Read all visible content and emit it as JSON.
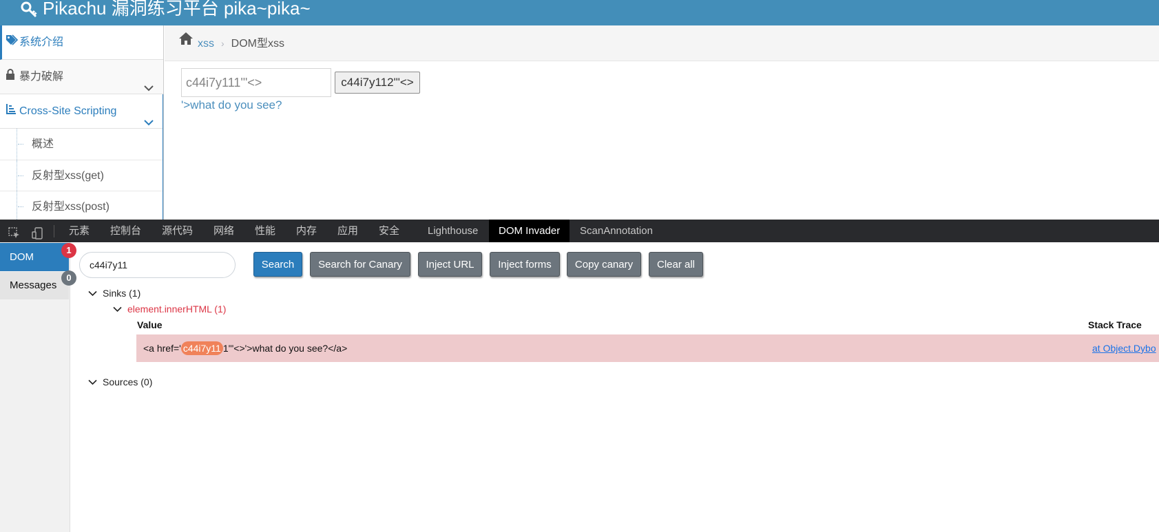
{
  "header": {
    "title": "Pikachu 漏洞练习平台 pika~pika~"
  },
  "sidebar": {
    "items": [
      {
        "label": "系统介绍",
        "icon": "tag-icon"
      },
      {
        "label": "暴力破解",
        "icon": "lock-icon"
      },
      {
        "label": "Cross-Site Scripting",
        "icon": "list-icon"
      }
    ],
    "subitems": [
      {
        "label": "概述"
      },
      {
        "label": "反射型xss(get)"
      },
      {
        "label": "反射型xss(post)"
      }
    ]
  },
  "breadcrumb": {
    "link": "xss",
    "current": "DOM型xss"
  },
  "xss_form": {
    "input_value": "c44i7y111'\"<>",
    "button_label": "c44i7y112'\"<>",
    "result_link": "'>what do you see?"
  },
  "devtools": {
    "tabs": [
      "元素",
      "控制台",
      "源代码",
      "网络",
      "性能",
      "内存",
      "应用",
      "安全",
      "Lighthouse",
      "DOM Invader",
      "ScanAnnotation"
    ],
    "active_tab": "DOM Invader"
  },
  "invader": {
    "left_tabs": {
      "dom": "DOM",
      "messages": "Messages"
    },
    "badges": {
      "dom": "1",
      "messages": "0"
    },
    "canary_value": "c44i7y11",
    "buttons": {
      "search": "Search",
      "search_canary": "Search for Canary",
      "inject_url": "Inject URL",
      "inject_forms": "Inject forms",
      "copy_canary": "Copy canary",
      "clear_all": "Clear all"
    },
    "sinks_label": "Sinks (1)",
    "sink_name": "element.innerHTML (1)",
    "col_value": "Value",
    "col_stack": "Stack Trace",
    "sink_row": {
      "prefix": "<a href='",
      "canary": "c44i7y11",
      "suffix": "1'\"<>'>what do you see?</a>"
    },
    "stack_trace": "at Object.Dybo",
    "sources_label": "Sources (0)"
  },
  "colors": {
    "header_bg": "#438eb9",
    "accent": "#2b7dbc",
    "danger": "#dc3545",
    "sink_row_bg": "#eecacc",
    "canary_highlight": "#f0825a"
  }
}
